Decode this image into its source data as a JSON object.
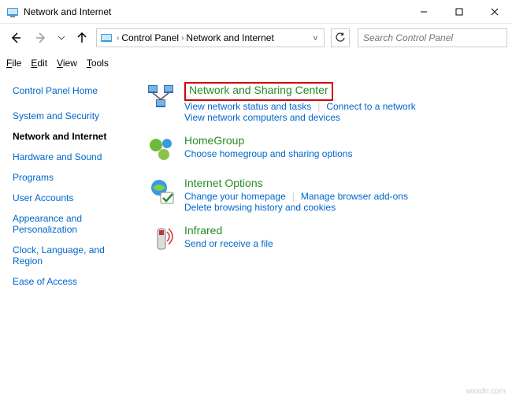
{
  "window": {
    "title": "Network and Internet"
  },
  "breadcrumb": {
    "root": "Control Panel",
    "current": "Network and Internet"
  },
  "search": {
    "placeholder": "Search Control Panel"
  },
  "menu": {
    "file": "File",
    "edit": "Edit",
    "view": "View",
    "tools": "Tools"
  },
  "sidebar": {
    "home": "Control Panel Home",
    "items": [
      "System and Security",
      "Network and Internet",
      "Hardware and Sound",
      "Programs",
      "User Accounts",
      "Appearance and Personalization",
      "Clock, Language, and Region",
      "Ease of Access"
    ]
  },
  "categories": {
    "network_sharing": {
      "title": "Network and Sharing Center",
      "link1": "View network status and tasks",
      "link2": "Connect to a network",
      "link3": "View network computers and devices"
    },
    "homegroup": {
      "title": "HomeGroup",
      "link1": "Choose homegroup and sharing options"
    },
    "internet_options": {
      "title": "Internet Options",
      "link1": "Change your homepage",
      "link2": "Manage browser add-ons",
      "link3": "Delete browsing history and cookies"
    },
    "infrared": {
      "title": "Infrared",
      "link1": "Send or receive a file"
    }
  },
  "watermark": "wsxdn.com"
}
